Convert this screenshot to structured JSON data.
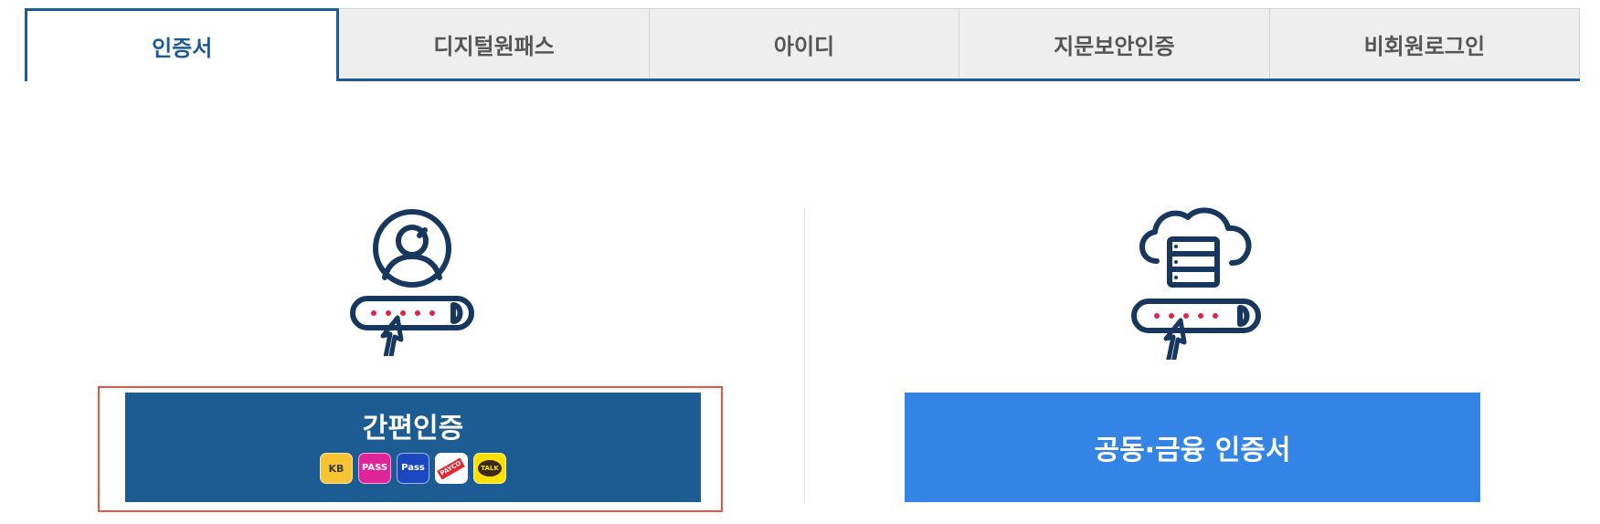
{
  "tabs": [
    {
      "label": "인증서",
      "active": true
    },
    {
      "label": "디지털원패스",
      "active": false
    },
    {
      "label": "아이디",
      "active": false
    },
    {
      "label": "지문보안인증",
      "active": false
    },
    {
      "label": "비회원로그인",
      "active": false
    }
  ],
  "simple_auth": {
    "label": "간편인증",
    "icon": "user-password-icon",
    "providers": [
      {
        "name": "kb-icon",
        "text": "KB"
      },
      {
        "name": "pass-icon",
        "text": "PASS"
      },
      {
        "name": "samsung-pass-icon",
        "text": "Pass"
      },
      {
        "name": "payco-icon",
        "text": "PAYCO"
      },
      {
        "name": "kakao-talk-icon",
        "text": "TALK"
      }
    ]
  },
  "certificate": {
    "label": "공동·금융 인증서",
    "icon": "cloud-server-password-icon"
  },
  "colors": {
    "tab_active": "#1b5a97",
    "tab_inactive_bg": "#eeeeee",
    "simple_button": "#1d5b93",
    "cert_button": "#3484e6",
    "highlight_outline": "#e9553f"
  }
}
